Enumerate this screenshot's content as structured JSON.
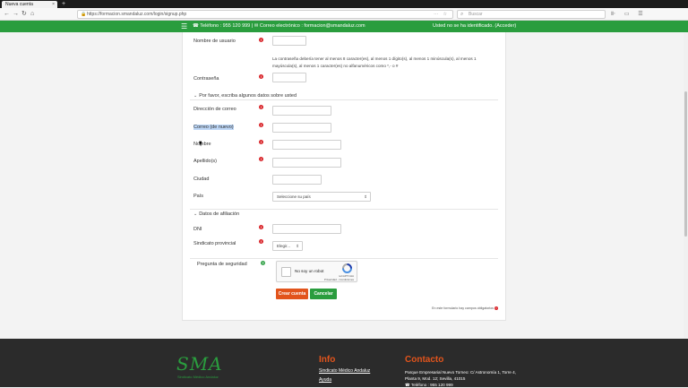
{
  "browser": {
    "tab_title": "Nueva cuenta",
    "tab_close": "×",
    "new_tab": "+",
    "url": "https://formacion.smandaluz.com/login/signup.php",
    "search_placeholder": "Buscar"
  },
  "header": {
    "contact": "☎ Teléfono : 955 120 999 | ✉ Correo electrónico : formacion@smandaluz.com",
    "login_status": "Usted no se ha identificado. (Acceder)"
  },
  "form": {
    "username_label": "Nombre de usuario",
    "password_rules": "La contraseña debería tener al menos 8 caracter(es), al menos 1 dígito(s), al menos 1 minúscula(s), al menos 1 mayúscula(s), al menos 1 caracter(es) no alfanuméricos como *,- o #",
    "password_label": "Contraseña",
    "section_more": "Por favor, escriba algunos datos sobre usted",
    "email_label": "Dirección de correo",
    "email_again_label": "Correo (de nuevo)",
    "firstname_label": "Nombre",
    "lastname_label": "Apellido(s)",
    "city_label": "Ciudad",
    "country_label": "País",
    "country_value": "Seleccione su país",
    "section_affiliation": "Datos de afiliación",
    "dni_label": "DNI",
    "provincial_label": "Sindicato provincial",
    "provincial_value": "Elegir...",
    "security_label": "Pregunta de seguridad",
    "captcha_text": "No soy un robot",
    "captcha_brand": "reCAPTCHA",
    "captcha_links": "Privacidad - Condiciones",
    "create_button": "Crear cuenta",
    "cancel_button": "Cancelar",
    "required_note": "En este formulario hay campos obligatorios"
  },
  "footer": {
    "logo_text": "SMA",
    "logo_sub": "Sindicato Médico Andaluz",
    "info_title": "Info",
    "info_link_1": "Sindicato Médico Andaluz",
    "info_link_2": "Ayuda",
    "contact_title": "Contacto",
    "address": "Parque Empresarial Nuevo Torneo: C/ Astronomía 1, Torre 4, Planta 9, Mod. 12; Sevilla, 41015",
    "phone": "☎ Teléfono : 955 120 999"
  },
  "colors": {
    "green": "#2a9d3e",
    "orange": "#e2541c",
    "required_red": "#d9262b"
  }
}
